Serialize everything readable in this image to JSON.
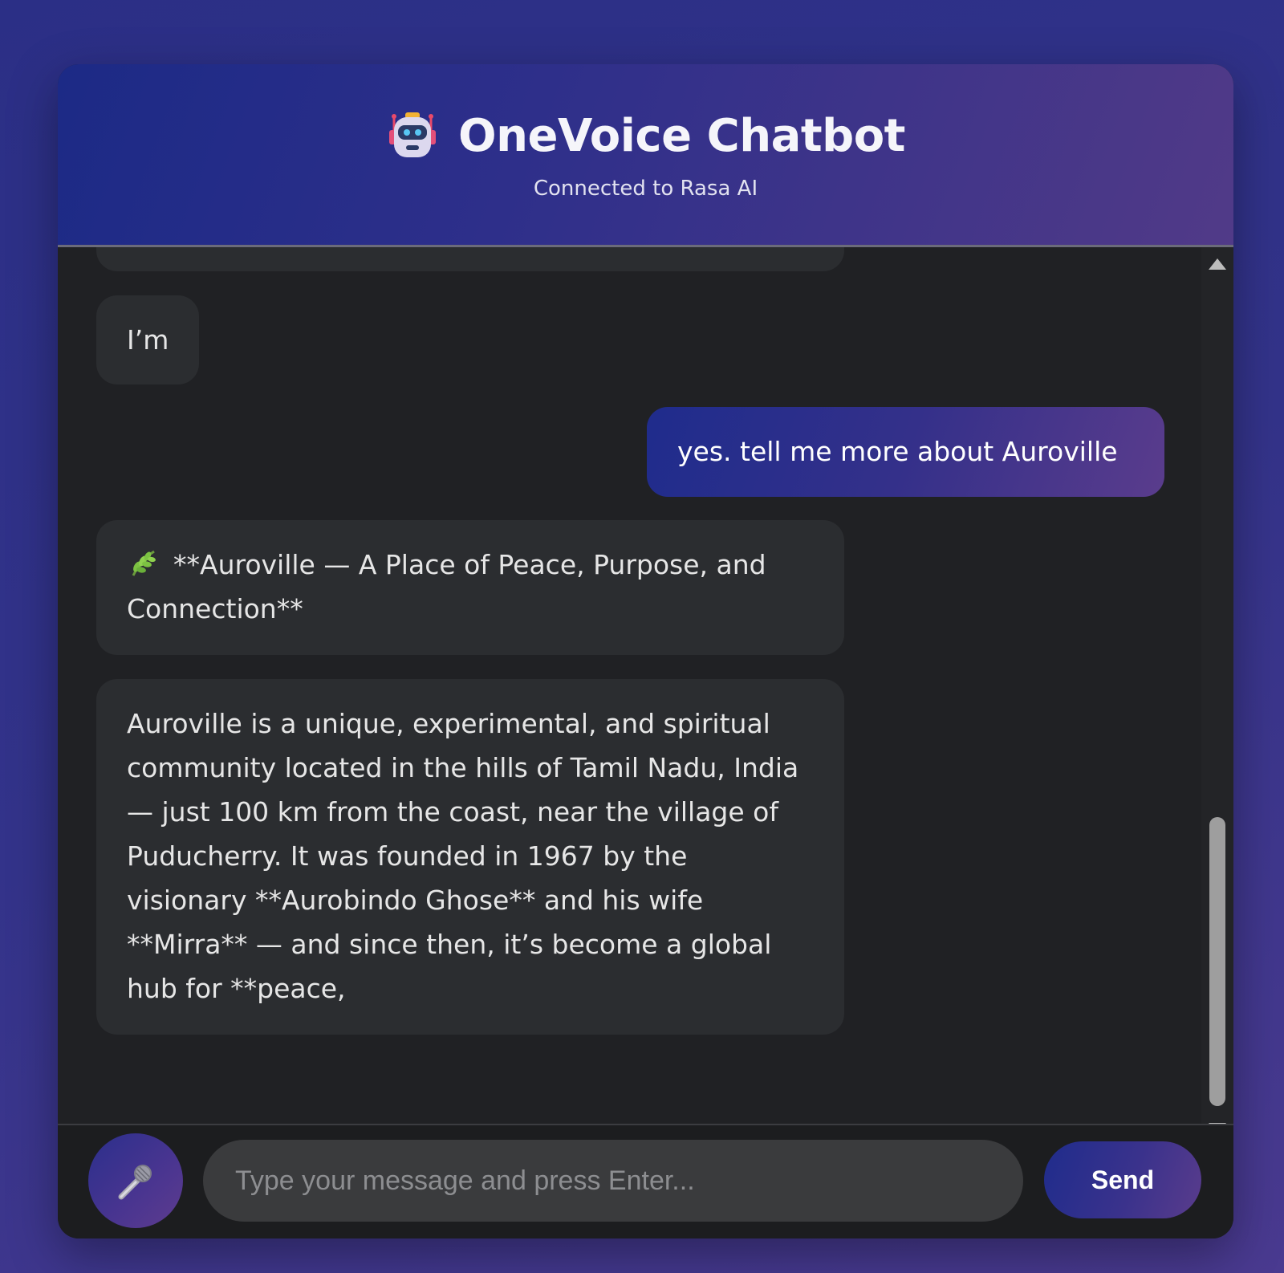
{
  "header": {
    "robot_icon": "robot-face-icon",
    "title": "OneVoice Chatbot",
    "subtitle": "Connected to Rasa AI",
    "gradient_start": "#1c2a86",
    "gradient_end": "#513a88"
  },
  "messages": [
    {
      "sender": "bot",
      "text": "I’m"
    },
    {
      "sender": "user",
      "text": "yes. tell me more about Auroville"
    },
    {
      "sender": "bot",
      "icon": "leaf-icon",
      "text": "**Auroville — A Place of Peace, Purpose, and Connection**"
    },
    {
      "sender": "bot",
      "text": "Auroville is a unique, experimental, and spiritual community located in the hills of Tamil Nadu, India — just 100 km from the coast, near the village of Puducherry. It was founded in 1967 by the visionary **Aurobindo Ghose** and his wife **Mirra** — and since then, it’s become a global hub for **peace,"
    }
  ],
  "composer": {
    "mic_icon": "microphone-icon",
    "placeholder": "Type your message and press Enter...",
    "value": "",
    "send_label": "Send"
  },
  "colors": {
    "page_background": "#2f318a",
    "chat_background": "#202124",
    "bot_bubble": "#2b2d30",
    "user_bubble_start": "#1f2c8c",
    "user_bubble_end": "#5a3c8c",
    "input_background": "#3a3b3d"
  }
}
